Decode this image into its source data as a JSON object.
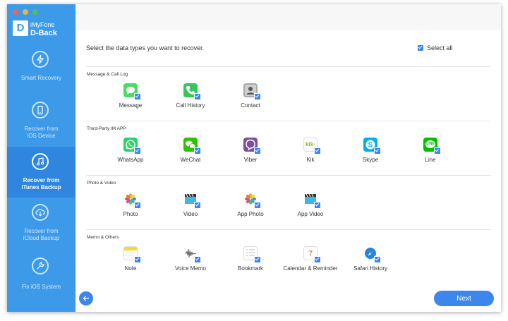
{
  "app": {
    "brand_top": "iMyFone",
    "brand_main": "D-Back",
    "logo_letter": "D"
  },
  "sidebar": {
    "items": [
      {
        "label": "Smart Recovery",
        "icon": "lightning-icon"
      },
      {
        "label": "Recover from\niOS Device",
        "icon": "phone-icon"
      },
      {
        "label": "Recover from\niTunes Backup",
        "icon": "music-note-icon",
        "active": true
      },
      {
        "label": "Recover from\niCloud Backup",
        "icon": "cloud-download-icon"
      },
      {
        "label": "Fix iOS System",
        "icon": "wrench-icon"
      }
    ]
  },
  "main": {
    "instruction": "Select the data types you want to recover.",
    "select_all": "Select all",
    "categories": [
      {
        "label": "Message & Call Log",
        "items": [
          {
            "label": "Message",
            "icon": "message-icon",
            "color": "#4cd964"
          },
          {
            "label": "Call History",
            "icon": "phone-call-icon",
            "color": "#34c759"
          },
          {
            "label": "Contact",
            "icon": "contact-icon",
            "color": "#9a9a9a"
          }
        ]
      },
      {
        "label": "Third-Party IM APP",
        "items": [
          {
            "label": "WhatsApp",
            "icon": "whatsapp-icon",
            "color": "#25d366"
          },
          {
            "label": "WeChat",
            "icon": "wechat-icon",
            "color": "#2dc100"
          },
          {
            "label": "Viber",
            "icon": "viber-icon",
            "color": "#7b519d"
          },
          {
            "label": "Kik",
            "icon": "kik-icon",
            "color": "#ffffff",
            "text": "kik·"
          },
          {
            "label": "Skype",
            "icon": "skype-icon",
            "color": "#00aff0"
          },
          {
            "label": "Line",
            "icon": "line-icon",
            "color": "#00c300",
            "text": "LINE"
          }
        ]
      },
      {
        "label": "Photo & Video",
        "items": [
          {
            "label": "Photo",
            "icon": "photos-icon",
            "color": "#f5a623"
          },
          {
            "label": "Video",
            "icon": "clapperboard-icon",
            "color": "#3fb6e8"
          },
          {
            "label": "App Photo",
            "icon": "app-photos-icon",
            "color": "#f5a623"
          },
          {
            "label": "App Video",
            "icon": "app-clapperboard-icon",
            "color": "#3fb6e8"
          }
        ]
      },
      {
        "label": "Memo & Others",
        "items": [
          {
            "label": "Note",
            "icon": "note-icon",
            "color": "#ffd52e"
          },
          {
            "label": "Voice Memo",
            "icon": "voice-memo-icon",
            "color": "#ffffff"
          },
          {
            "label": "Bookmark",
            "icon": "bookmark-icon",
            "color": "#ffffff"
          },
          {
            "label": "Calendar & Reminder",
            "icon": "calendar-icon",
            "color": "#ffffff",
            "text": "7"
          },
          {
            "label": "Safari History",
            "icon": "safari-icon",
            "color": "#1e88e5"
          }
        ]
      }
    ],
    "next_label": "Next"
  }
}
